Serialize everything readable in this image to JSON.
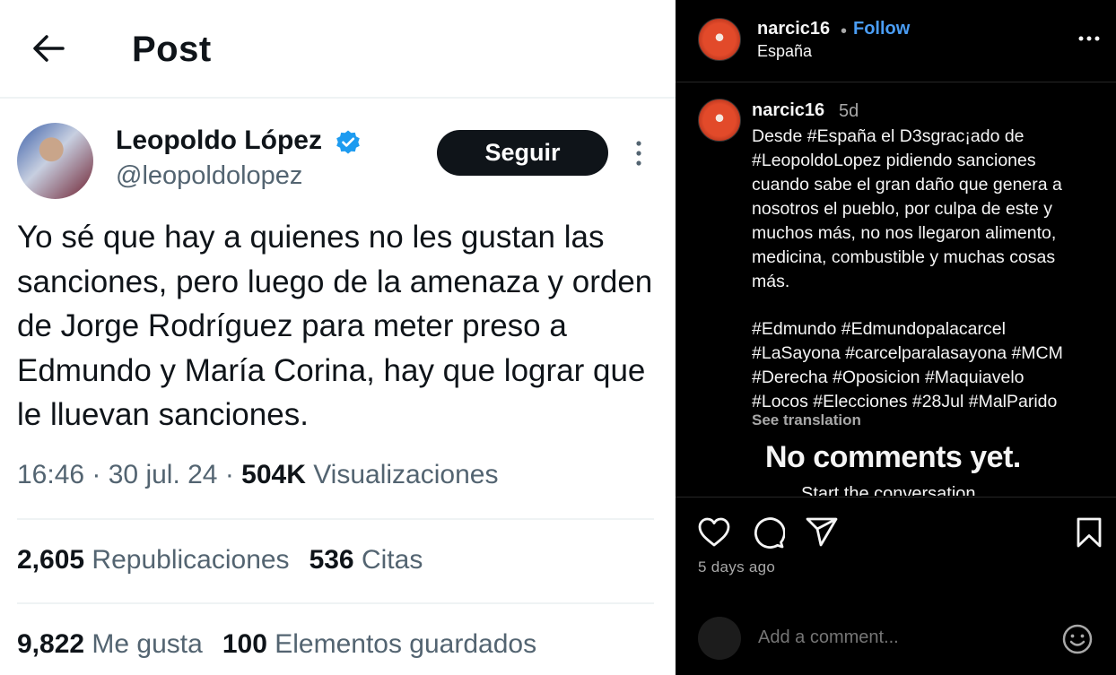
{
  "tweet": {
    "header_title": "Post",
    "author_name": "Leopoldo López",
    "author_handle": "@leopoldolopez",
    "follow_label": "Seguir",
    "text": "Yo sé que hay a quienes no les gustan las sanciones, pero luego de la amenaza y orden de Jorge Rodríguez para meter preso a Edmundo y María Corina, hay que lograr que le lluevan sanciones.",
    "time": "16:46 · 30 jul. 24 · ",
    "views_count": "504K",
    "views_label": "Visualizaciones",
    "reposts_count": "2,605",
    "reposts_label": "Republicaciones",
    "quotes_count": "536",
    "quotes_label": "Citas",
    "likes_count": "9,822",
    "likes_label": "Me gusta",
    "bookmarks_count": "100",
    "bookmarks_label": "Elementos guardados",
    "colors": {
      "verified": "#1d9bf0",
      "text": "#0f1419",
      "muted": "#536471"
    }
  },
  "instagram": {
    "username": "narcic16",
    "separator": "•",
    "follow_label": "Follow",
    "location": "España",
    "caption_username": "narcic16",
    "caption_time": "5d",
    "caption": "Desde #España el D3sgrac¡ado de\n#LeopoldoLopez pidiendo sanciones\ncuando sabe el gran daño que genera a\nnosotros el pueblo, por culpa de este y\nmuchos más, no nos llegaron alimento,\nmedicina, combustible y muchas cosas\nmás.",
    "hashtag_lines": [
      "#Edmundo #Edmundopalacarcel",
      "#LaSayona #carcelparalasayona #MCM",
      "#Derecha #Oposicion #Maquiavelo",
      "#Locos #Elecciones #28Jul #MalParido"
    ],
    "see_translation": "See translation",
    "no_comments": "No comments yet.",
    "cut_text": "Start the conversation.",
    "date": "5 days ago",
    "comment_placeholder": "Add a comment...",
    "icons": [
      "heart-icon",
      "comment-icon",
      "share-icon",
      "bookmark-icon",
      "emoji-icon",
      "more-icon"
    ],
    "colors": {
      "follow": "#4a9df5",
      "muted": "#a8a8a8",
      "background": "#000000"
    }
  }
}
